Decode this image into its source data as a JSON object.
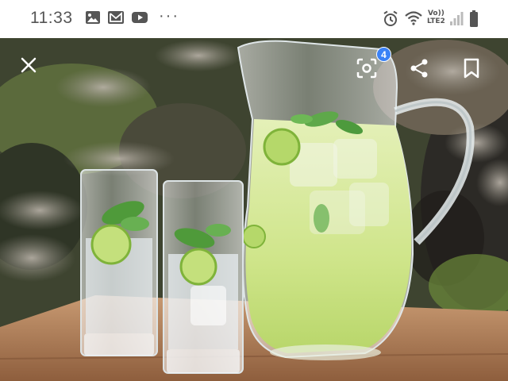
{
  "status_bar": {
    "time": "11:33",
    "left_icons": [
      "gallery-icon",
      "mail-icon",
      "youtube-icon"
    ],
    "more": "···",
    "network_label_top": "Vo))",
    "network_label_bottom": "LTE2",
    "right_icons": [
      "alarm-icon",
      "wifi-icon",
      "signal-icon",
      "battery-icon"
    ]
  },
  "viewer": {
    "close_icon": "close-icon",
    "lens_icon": "lens-icon",
    "lens_badge": "4",
    "share_icon": "share-icon",
    "bookmark_icon": "bookmark-icon",
    "image_subject": "limeade-pitcher-and-glasses"
  },
  "colors": {
    "badge": "#3b82f6",
    "status_text": "#555555",
    "drink": "#d6e89a"
  }
}
